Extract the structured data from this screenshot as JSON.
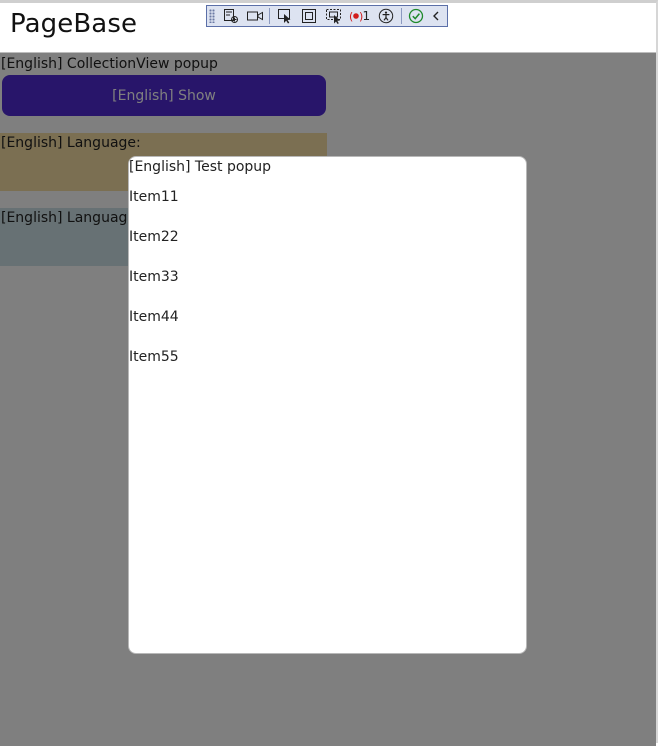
{
  "page": {
    "title": "PageBase"
  },
  "toolbar": {
    "count_label": "1",
    "icons": [
      "grip",
      "live-visual-tree-icon",
      "video-camera-icon",
      "select-element-icon",
      "display-layout-adorners-icon",
      "track-focused-element-icon",
      "binding-failures-icon",
      "accessibility-icon",
      "hot-reload-status-icon",
      "collapse-toolbar-icon"
    ]
  },
  "main": {
    "collection_label": "[English] CollectionView popup",
    "show_button_label": "[English] Show",
    "language_label_1": "[English] Language:",
    "language_label_2": "[English] Language:"
  },
  "popup": {
    "title": "[English] Test popup",
    "items": [
      "Item11",
      "Item22",
      "Item33",
      "Item44",
      "Item55"
    ]
  },
  "colors": {
    "button": "#512bd4",
    "band_1": "#f7dfa5",
    "band_2": "#cfe3e8",
    "overlay": "rgba(0,0,0,0.5)"
  }
}
